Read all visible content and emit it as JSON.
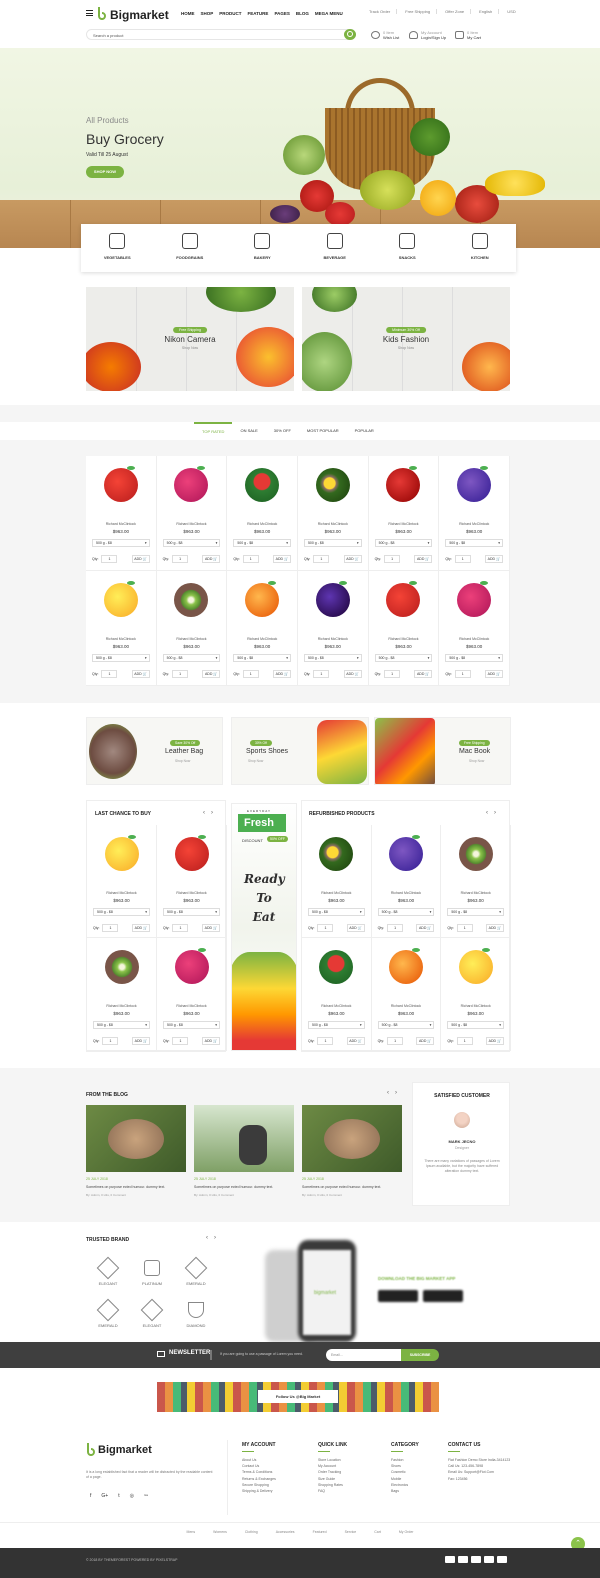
{
  "header": {
    "brand": "Bigmarket",
    "nav": [
      "HOME",
      "SHOP",
      "PRODUCT",
      "FEATURE",
      "PAGES",
      "BLOG",
      "MEGA MENU"
    ],
    "top_links": [
      "Track Order",
      "Free Shipping",
      "Offer Zone",
      "English",
      "USD"
    ],
    "search_placeholder": "Search a product",
    "wishlist": {
      "count": "0 Item",
      "label": "Wish List"
    },
    "account": {
      "title": "My Account",
      "label": "Login/Sign Up"
    },
    "cart": {
      "count": "0 Item",
      "label": "My Cart"
    }
  },
  "hero": {
    "subtitle": "All Products",
    "title": "Buy Grocery",
    "valid": "Valid Till 25 August",
    "button": "SHOP NOW"
  },
  "categories": [
    "VEGETABLES",
    "FOODGRAINS",
    "BAKERY",
    "BEVERAGE",
    "SNACKS",
    "KITCHEN"
  ],
  "promos": [
    {
      "badge": "Free Shipping",
      "title": "Nikon Camera",
      "link": "Shop Now"
    },
    {
      "badge": "Minimum 30% Off",
      "title": "Kids Fashion",
      "link": "Shop Now"
    }
  ],
  "tabs": [
    "TOP RATED",
    "ON SALE",
    "30% OFF",
    "MOST POPULAR",
    "POPULAR"
  ],
  "product_common": {
    "name": "Richard McClintock",
    "price": "$963.00",
    "variant": "500 g - $8",
    "qty_label": "Qty:",
    "qty": "1",
    "add": "ADD 🛒"
  },
  "products_grid": [
    "apple",
    "dragonfruit",
    "watermelon",
    "avocado",
    "cherry",
    "grapes",
    "pear",
    "kiwi",
    "apricot",
    "blackberry",
    "apple",
    "dragonfruit"
  ],
  "mid_banners": [
    {
      "badge": "Save 30% Off",
      "title": "Leather Bag",
      "link": "Shop Now"
    },
    {
      "badge": "30% Off",
      "title": "Sports Shoes",
      "link": "Shop Now"
    },
    {
      "badge": "Free Shipping",
      "title": "Mac Book",
      "link": "Shop Now"
    }
  ],
  "last_chance": {
    "title": "LAST CHANCE TO BUY",
    "items": [
      "pear",
      "apple",
      "kiwi",
      "dragonfruit"
    ]
  },
  "fresh": {
    "small": "EVERYDAY",
    "title": "Fresh",
    "discount": "DISCOUNT",
    "pct": "50% OFF",
    "script": [
      "Ready",
      "To",
      "Eat"
    ]
  },
  "refurbished": {
    "title": "REFURBISHED PRODUCTS",
    "items": [
      "avocado",
      "grapes",
      "kiwi",
      "watermelon",
      "apricot",
      "pear"
    ]
  },
  "blog": {
    "title": "FROM THE BLOG",
    "posts": [
      {
        "date": "25 JULY 2018",
        "text": "Sometimes on purpose ected humour. dummy text.",
        "meta": "By: Admin, 0 Hits, 0 Comment"
      },
      {
        "date": "25 JULY 2018",
        "text": "Sometimes on purpose ected humour. dummy text.",
        "meta": "By: Admin, 0 Hits, 0 Comment"
      },
      {
        "date": "25 JULY 2018",
        "text": "Sometimes on purpose ected humour. dummy text.",
        "meta": "By: Admin, 0 Hits, 0 Comment"
      }
    ]
  },
  "testimonial": {
    "title": "SATISFIED CUSTOMER",
    "name": "MARK JECNO",
    "role": "Designer",
    "text": "There are many variations of passages of Lorem Ipsum available, but the majority have suffered alteration dummy text."
  },
  "brands": {
    "title": "TRUSTED BRAND",
    "items": [
      "ELEGANT",
      "PLATINUM",
      "EMERALD",
      "EMERALD",
      "ELEGANT",
      "DIAMOND"
    ]
  },
  "app": {
    "title": "DOWNLOAD THE BIG MARKET APP",
    "screen_brand": "bigmarket"
  },
  "newsletter": {
    "title": "NEWSLETTER",
    "text": "If you are going to use a passage of Lorem you need.",
    "placeholder": "Email...",
    "button": "SUBSCRIBE"
  },
  "instagram": {
    "label": "Follow Us @Big Market"
  },
  "footer": {
    "brand": "Bigmarket",
    "about": "It is a long established fact that a reader will be distracted by the readable content of a page.",
    "social": [
      "f",
      "G+",
      "t",
      "◎",
      "rss"
    ],
    "columns": [
      {
        "title": "MY ACCOUNT",
        "items": [
          "About Us",
          "Contact Us",
          "Terms & Conditions",
          "Returns & Exchanges",
          "Secure Shopping",
          "Shipping & Delivery"
        ]
      },
      {
        "title": "QUICK LINK",
        "items": [
          "Store Location",
          "My Account",
          "Order Tracking",
          "Size Guide",
          "Shopping Rates",
          "FAQ"
        ]
      },
      {
        "title": "CATEGORY",
        "items": [
          "Fashion",
          "Shoes",
          "Cosmetic",
          "Mobile",
          "Electronics",
          "Bags"
        ]
      }
    ],
    "contact": {
      "title": "CONTACT US",
      "items": [
        "Flat Fashion Demo Store India-3414123",
        "Call Us: 123-456-7898",
        "Email Us: Support@Fiot.Com",
        "Fax: 123456"
      ]
    },
    "bottom_links": [
      "Mens",
      "Womens",
      "Clothing",
      "Accessories",
      "Featured",
      "Service",
      "Cart",
      "My Order"
    ],
    "copyright": "© 2018 BY THEMEFOREST POWERED BY PIXELSTRAP"
  },
  "colors": {
    "accent": "#7cb342",
    "dark": "#3f3f3f"
  }
}
